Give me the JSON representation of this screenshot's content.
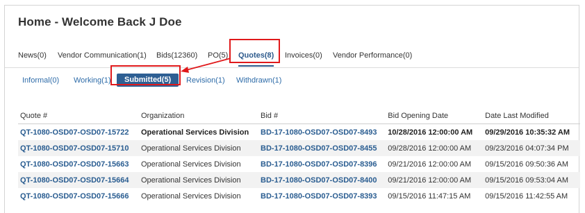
{
  "page": {
    "title": "Home - Welcome Back J Doe"
  },
  "main_tabs": [
    {
      "label": "News(0)"
    },
    {
      "label": "Vendor Communication(1)"
    },
    {
      "label": "Bids(12360)"
    },
    {
      "label": "PO(5)"
    },
    {
      "label": "Quotes(8)",
      "active": true
    },
    {
      "label": "Invoices(0)"
    },
    {
      "label": "Vendor Performance(0)"
    }
  ],
  "sub_tabs": [
    {
      "label": "Informal(0)"
    },
    {
      "label": "Working(1)"
    },
    {
      "label": "Submitted(5)",
      "active": true
    },
    {
      "label": "Revision(1)"
    },
    {
      "label": "Withdrawn(1)"
    }
  ],
  "table": {
    "headers": [
      "Quote #",
      "Organization",
      "Bid #",
      "Bid Opening Date",
      "Date Last Modified"
    ],
    "rows": [
      {
        "quote": "QT-1080-OSD07-OSD07-15722",
        "org": "Operational Services Division",
        "bid": "BD-17-1080-OSD07-OSD07-8493",
        "opening": "10/28/2016 12:00:00 AM",
        "modified": "09/29/2016 10:35:32 AM"
      },
      {
        "quote": "QT-1080-OSD07-OSD07-15710",
        "org": "Operational Services Division",
        "bid": "BD-17-1080-OSD07-OSD07-8455",
        "opening": "09/28/2016 12:00:00 AM",
        "modified": "09/23/2016 04:07:34 PM"
      },
      {
        "quote": "QT-1080-OSD07-OSD07-15663",
        "org": "Operational Services Division",
        "bid": "BD-17-1080-OSD07-OSD07-8396",
        "opening": "09/21/2016 12:00:00 AM",
        "modified": "09/15/2016 09:50:36 AM"
      },
      {
        "quote": "QT-1080-OSD07-OSD07-15664",
        "org": "Operational Services Division",
        "bid": "BD-17-1080-OSD07-OSD07-8400",
        "opening": "09/21/2016 12:00:00 AM",
        "modified": "09/15/2016 09:53:04 AM"
      },
      {
        "quote": "QT-1080-OSD07-OSD07-15666",
        "org": "Operational Services Division",
        "bid": "BD-17-1080-OSD07-OSD07-8393",
        "opening": "09/15/2016 11:47:15 AM",
        "modified": "09/15/2016 11:42:55 AM"
      }
    ]
  },
  "colors": {
    "accent": "#2e5f93",
    "link": "#2a5d91",
    "highlight": "#e0191b",
    "row_shade": "#f2f2f2"
  }
}
